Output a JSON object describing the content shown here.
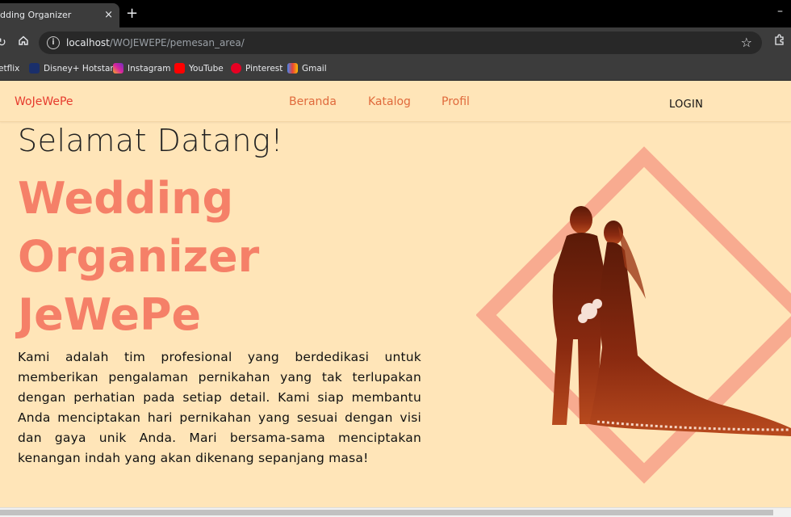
{
  "browser": {
    "tab_title": "dding Organizer",
    "tab_close": "×",
    "new_tab": "+",
    "minimize": "–",
    "url_host": "localhost",
    "url_path": "/WOJEWEPE/pemesan_area/",
    "bookmarks": [
      {
        "label": "etflix",
        "icon": "netflix-icon",
        "color": "#3c3c3c"
      },
      {
        "label": "Disney+ Hotstar",
        "icon": "disney-hotstar-icon",
        "color": "#1a2f6b"
      },
      {
        "label": "Instagram",
        "icon": "instagram-icon",
        "color": "#d6249f"
      },
      {
        "label": "YouTube",
        "icon": "youtube-icon",
        "color": "#ff0000"
      },
      {
        "label": "Pinterest",
        "icon": "pinterest-icon",
        "color": "#e60023"
      },
      {
        "label": "Gmail",
        "icon": "gmail-icon",
        "color": "#ea4335"
      }
    ]
  },
  "navbar": {
    "brand": "WoJeWePe",
    "links": [
      "Beranda",
      "Katalog",
      "Profil"
    ],
    "login": "LOGIN"
  },
  "hero": {
    "greeting": "Selamat Datang!",
    "title_lines": [
      "Wedding",
      "Organizer",
      "JeWePe"
    ],
    "description": "Kami adalah tim profesional yang berdedikasi untuk memberikan pengalaman pernikahan yang tak terlupakan dengan perhatian pada setiap detail. Kami siap membantu Anda menciptakan hari pernikahan yang sesuai dengan visi dan gaya unik Anda. Mari bersama-sama menciptakan kenangan indah yang akan dikenang sepanjang masa!"
  },
  "colors": {
    "page_bg": "#ffe5b8",
    "brand": "#e63b2e",
    "nav_link": "#e06a3c",
    "hero_title": "#f58068",
    "diamond": "#f8a88d",
    "couple": "#8a2a10"
  }
}
